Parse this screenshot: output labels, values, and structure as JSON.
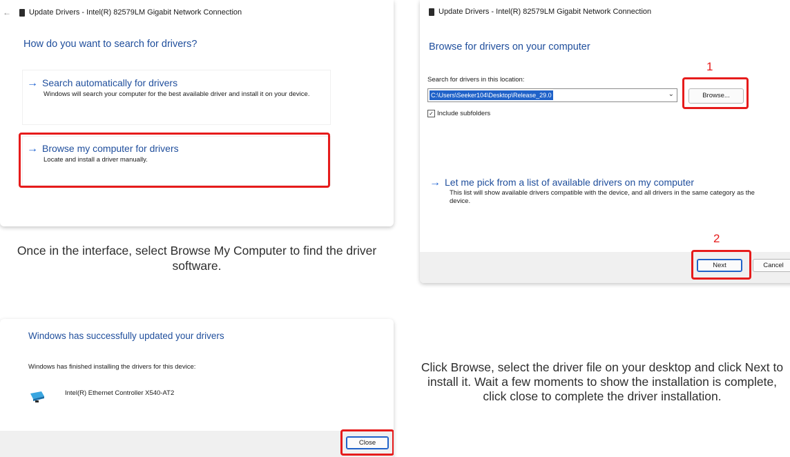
{
  "panel1": {
    "back_glyph": "←",
    "title": "Update Drivers - Intel(R) 82579LM Gigabit Network Connection",
    "heading": "How do you want to search for drivers?",
    "option1_title": "Search automatically for drivers",
    "option1_desc": "Windows will search your computer for the best available driver and install it on your device.",
    "option2_title": "Browse my computer for drivers",
    "option2_desc": "Locate and install a driver manually."
  },
  "caption1": "Once in the interface, select Browse My Computer to find the driver software.",
  "panel2": {
    "title": "Update Drivers - Intel(R) 82579LM Gigabit Network Connection",
    "heading": "Browse for drivers on your computer",
    "search_label": "Search for drivers in this location:",
    "path_value": "C:\\Users\\Seeker104\\Desktop\\Release_29.0",
    "browse_label": "Browse...",
    "include_subfolders": "Include subfolders",
    "pick_title": "Let me pick from a list of available drivers on my computer",
    "pick_desc": "This list will show available drivers compatible with the device, and all drivers in the same category as the device.",
    "next_label": "Next",
    "cancel_label": "Cancel",
    "marker1": "1",
    "marker2": "2"
  },
  "panel3": {
    "heading": "Windows has successfully updated your drivers",
    "finished_text": "Windows has finished installing the drivers for this device:",
    "device_name": "Intel(R) Ethernet Controller X540-AT2",
    "close_label": "Close"
  },
  "caption2": "Click Browse, select the driver file on your desktop and click Next to install it. Wait a few moments to show the installation is complete, click close to complete the driver installation.",
  "colors": {
    "accent_blue": "#1f4e9c",
    "highlight_red": "#e61b1b",
    "selection_blue": "#1f62c9"
  }
}
